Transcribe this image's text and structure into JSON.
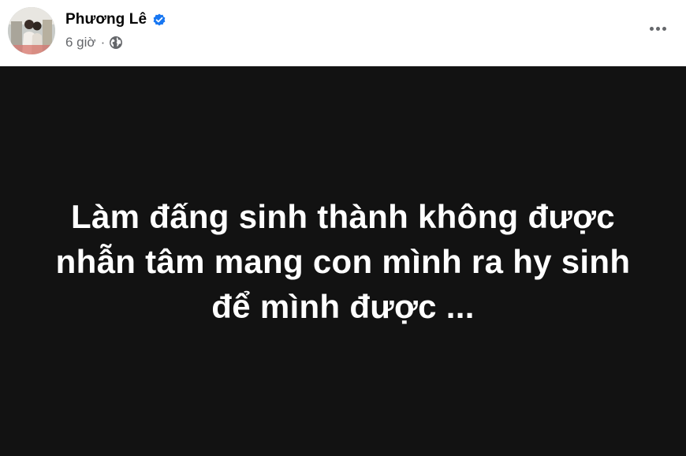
{
  "post": {
    "author": {
      "name": "Phương Lê",
      "verified": true,
      "avatar_icon": "profile-photo"
    },
    "time": "6 giờ",
    "separator": "·",
    "privacy_icon": "globe-icon",
    "more_icon": "more-options-icon",
    "text_lines": [
      "Làm đấng sinh thành không được",
      "nhẫn tâm mang con mình ra hy sinh",
      "để mình được ..."
    ],
    "colors": {
      "background": "#121212",
      "text": "#ffffff",
      "verified": "#1877f2",
      "meta": "#65676b"
    }
  }
}
